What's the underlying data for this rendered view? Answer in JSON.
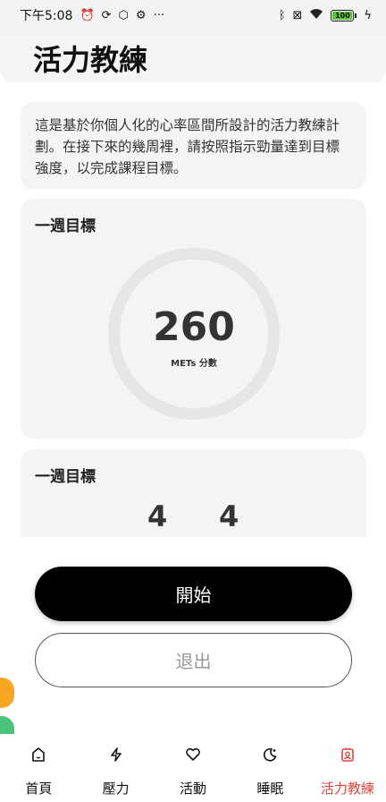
{
  "status_bar": {
    "time": "下午5:08",
    "battery_level": "100"
  },
  "header": {
    "title": "活力教練"
  },
  "intro": {
    "text": "這是基於你個人化的心率區間所設計的活力教練計劃。在接下來的幾周裡，請按照指示勁量達到目標強度，以完成課程目標。"
  },
  "weekly_goal": {
    "title": "一週目標",
    "value": "260",
    "unit": "METs 分數"
  },
  "weekly_goal_2": {
    "title": "一週目標",
    "stat_a": "4",
    "stat_b": "4"
  },
  "actions": {
    "start_label": "開始",
    "exit_label": "退出"
  },
  "tabs": [
    {
      "label": "首頁",
      "icon": "home-icon"
    },
    {
      "label": "壓力",
      "icon": "lightning-icon"
    },
    {
      "label": "活動",
      "icon": "heart-icon"
    },
    {
      "label": "睡眠",
      "icon": "moon-icon"
    },
    {
      "label": "活力教練",
      "icon": "coach-icon",
      "active": true
    }
  ],
  "colors": {
    "accent": "#e0443e",
    "primary_button": "#000000",
    "card_bg": "#f4f4f4"
  }
}
